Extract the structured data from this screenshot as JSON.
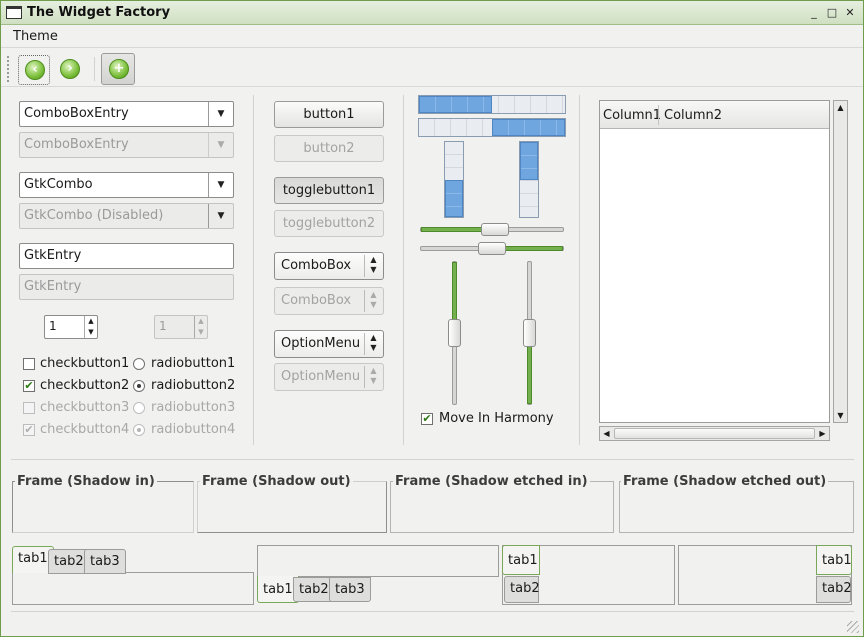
{
  "window": {
    "title": "The Widget Factory",
    "controls": [
      "_",
      "□",
      "✕"
    ]
  },
  "menubar": {
    "theme": "Theme"
  },
  "toolbar": {
    "back": "back-icon",
    "forward": "forward-icon",
    "add": "add-icon"
  },
  "col1": {
    "comboentry1": "ComboBoxEntry",
    "comboentry2": "ComboBoxEntry",
    "gtkcombo1": "GtkCombo",
    "gtkcombo2": "GtkCombo (Disabled)",
    "entry1": "GtkEntry",
    "entry2": "GtkEntry",
    "spin1": "1",
    "spin2": "1",
    "check1": "checkbutton1",
    "check2": "checkbutton2",
    "check3": "checkbutton3",
    "check4": "checkbutton4",
    "radio1": "radiobutton1",
    "radio2": "radiobutton2",
    "radio3": "radiobutton3",
    "radio4": "radiobutton4"
  },
  "col2": {
    "button1": "button1",
    "button2": "button2",
    "toggle1": "togglebutton1",
    "toggle2": "togglebutton2",
    "combobox1": "ComboBox",
    "combobox2": "ComboBox",
    "option1": "OptionMenu",
    "option2": "OptionMenu"
  },
  "col3": {
    "harmony": "Move In Harmony",
    "hprogress1_fraction": 0.5,
    "hprogress2_fraction": 0.5,
    "vprogress1_fraction": 0.5,
    "vprogress2_fraction": 0.5,
    "hscale1_value": 0.5,
    "hscale2_value": 0.5,
    "vscale1_value": 0.5,
    "vscale2_value": 0.5
  },
  "tree": {
    "col1": "Column1",
    "col2": "Column2"
  },
  "frames": {
    "in": "Frame (Shadow in)",
    "out": "Frame (Shadow out)",
    "etched_in": "Frame (Shadow etched in)",
    "etched_out": "Frame (Shadow etched out)"
  },
  "notebooks": {
    "nb1": [
      "tab1",
      "tab2",
      "tab3"
    ],
    "nb2": [
      "tab1",
      "tab2",
      "tab3"
    ],
    "nb3": [
      "tab1",
      "tab2"
    ],
    "nb4": [
      "tab1",
      "tab2"
    ]
  }
}
